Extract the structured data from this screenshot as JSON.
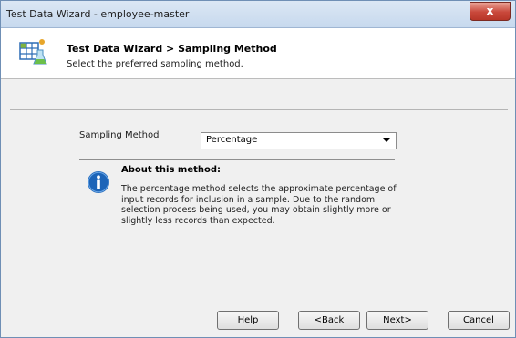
{
  "window": {
    "title": "Test Data Wizard - employee-master",
    "close_glyph": "x"
  },
  "header": {
    "title": "Test Data Wizard > Sampling Method",
    "subtitle": "Select the preferred sampling method.",
    "icon": "wizard-table-flask-icon"
  },
  "form": {
    "sampling_label": "Sampling Method",
    "sampling_value": "Percentage"
  },
  "about": {
    "icon": "info-icon",
    "title": "About this method:",
    "body": "The percentage method selects the approximate percentage of\ninput records for inclusion in a sample. Due to the random\nselection process being used, you may obtain slightly more or\nslightly less records than expected."
  },
  "buttons": {
    "help": "Help",
    "back": "<Back",
    "next": "Next>",
    "cancel": "Cancel"
  },
  "colors": {
    "close_button": "#c9483b",
    "info_icon": "#1c64b8",
    "titlebar": "#c7d9ee"
  }
}
